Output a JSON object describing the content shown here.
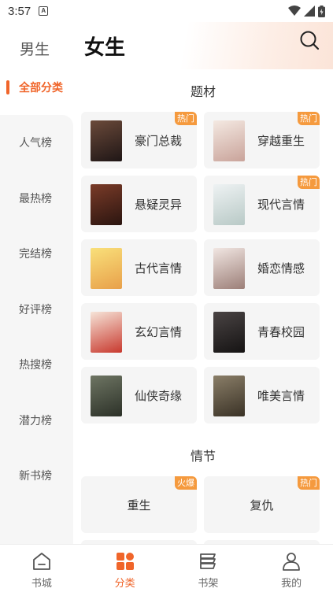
{
  "status": {
    "time": "3:57",
    "notif_glyph": "A"
  },
  "header": {
    "tab_male": "男生",
    "tab_female": "女生",
    "search_icon": "search-icon"
  },
  "sidebar": {
    "all_label": "全部分类",
    "items": [
      "人气榜",
      "最热榜",
      "完结榜",
      "好评榜",
      "热搜榜",
      "潜力榜",
      "新书榜"
    ]
  },
  "sections": [
    {
      "title": "题材",
      "cards": [
        {
          "label": "豪门总裁",
          "badge": "热门",
          "cover_color": "#3b2b2b"
        },
        {
          "label": "穿越重生",
          "badge": "热门",
          "cover_color": "#e9d8cf"
        },
        {
          "label": "悬疑灵异",
          "badge": "",
          "cover_color": "#4a2a22"
        },
        {
          "label": "现代言情",
          "badge": "热门",
          "cover_color": "#dfe7ea"
        },
        {
          "label": "古代言情",
          "badge": "",
          "cover_color": "#f3c95a"
        },
        {
          "label": "婚恋情感",
          "badge": "",
          "cover_color": "#d9c7c1"
        },
        {
          "label": "玄幻言情",
          "badge": "",
          "cover_color": "#d44b3d"
        },
        {
          "label": "青春校园",
          "badge": "",
          "cover_color": "#2d2a2a"
        },
        {
          "label": "仙侠奇缘",
          "badge": "",
          "cover_color": "#4b5340"
        },
        {
          "label": "唯美言情",
          "badge": "",
          "cover_color": "#6a6050"
        }
      ]
    },
    {
      "title": "情节",
      "cards": [
        {
          "label": "重生",
          "badge": "火爆"
        },
        {
          "label": "复仇",
          "badge": "热门"
        }
      ]
    }
  ],
  "bottom_nav": [
    {
      "label": "书城",
      "icon": "bookstore-icon",
      "active": false
    },
    {
      "label": "分类",
      "icon": "category-icon",
      "active": true
    },
    {
      "label": "书架",
      "icon": "bookshelf-icon",
      "active": false
    },
    {
      "label": "我的",
      "icon": "profile-icon",
      "active": false
    }
  ],
  "colors": {
    "accent": "#f0652a",
    "badge": "#f59a3e",
    "card_bg": "#f5f5f5"
  }
}
